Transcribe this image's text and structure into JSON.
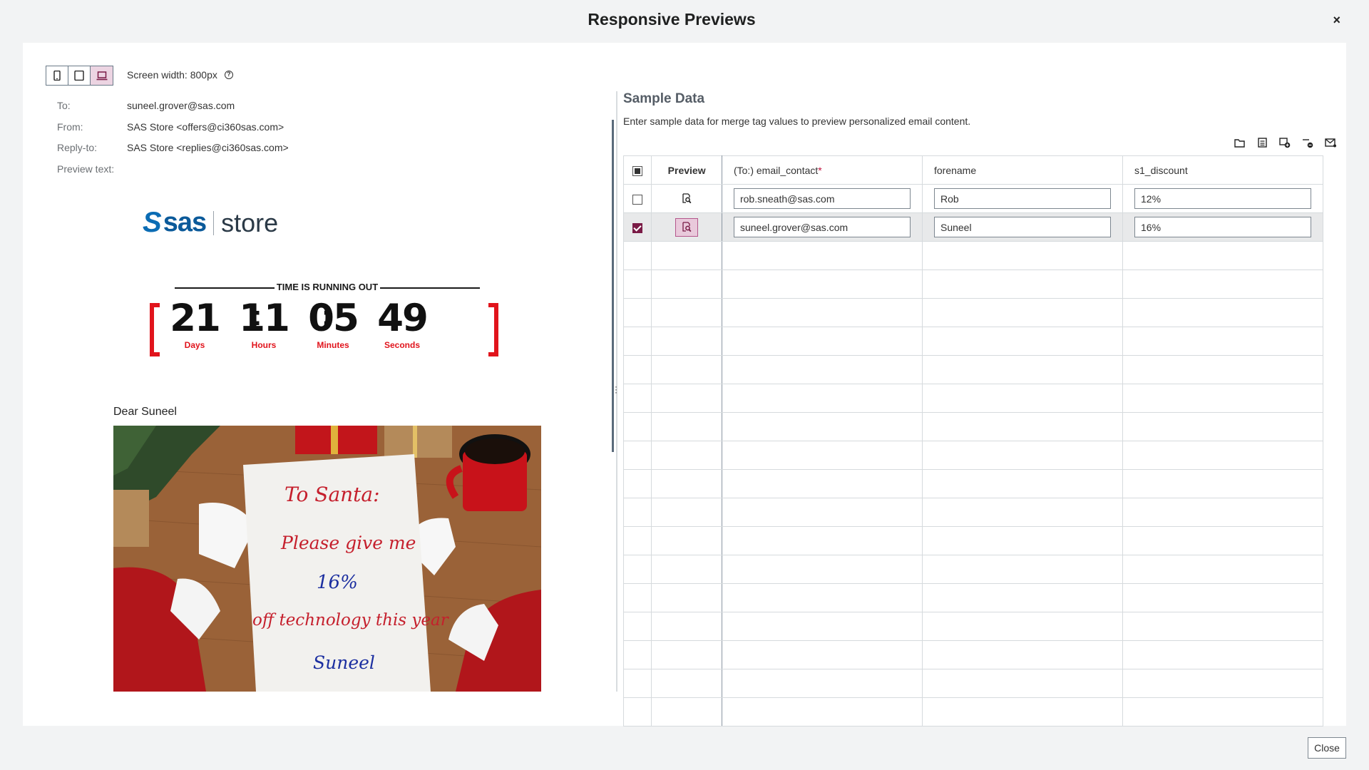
{
  "dialog": {
    "title": "Responsive Previews",
    "close_symbol": "×",
    "close_button": "Close"
  },
  "preview": {
    "screen_width": "Screen width: 800px",
    "device_modes": [
      "mobile",
      "tablet",
      "desktop"
    ],
    "active_mode": "desktop",
    "meta": [
      {
        "label": "To:",
        "value": "suneel.grover@sas.com"
      },
      {
        "label": "From:",
        "value": "SAS Store <offers@ci360sas.com>"
      },
      {
        "label": "Reply-to:",
        "value": "SAS Store <replies@ci360sas.com>"
      },
      {
        "label": "Preview text:",
        "value": ""
      }
    ],
    "logo": {
      "brand": "sas",
      "mark": "S",
      "product": "store"
    },
    "countdown": {
      "header": "TIME IS RUNNING OUT",
      "units": [
        {
          "value": "21",
          "caption": "Days"
        },
        {
          "value": "11",
          "caption": "Hours"
        },
        {
          "value": "05",
          "caption": "Minutes"
        },
        {
          "value": "49",
          "caption": "Seconds"
        }
      ]
    },
    "greeting": "Dear Suneel",
    "letter": {
      "line1": "To Santa:",
      "line2": "Please give me",
      "line3": "16%",
      "line4": "off technology this year",
      "line5": "Suneel"
    }
  },
  "sample_data": {
    "title": "Sample Data",
    "description": "Enter sample data for merge tag values to preview personalized email content.",
    "toolbar": [
      "folder-icon",
      "list-icon",
      "add-row-icon",
      "remove-row-icon",
      "email-icon"
    ],
    "columns": {
      "preview": "Preview",
      "email": "(To:) email_contact",
      "required": "*",
      "forename": "forename",
      "discount": "s1_discount"
    },
    "rows": [
      {
        "checked": false,
        "email": "rob.sneath@sas.com",
        "forename": "Rob",
        "discount": "12%"
      },
      {
        "checked": true,
        "email": "suneel.grover@sas.com",
        "forename": "Suneel",
        "discount": "16%"
      }
    ]
  },
  "colors": {
    "accent": "#7a1b46",
    "countdown_red": "#e1141c",
    "sas_blue": "#0b6cb4"
  }
}
